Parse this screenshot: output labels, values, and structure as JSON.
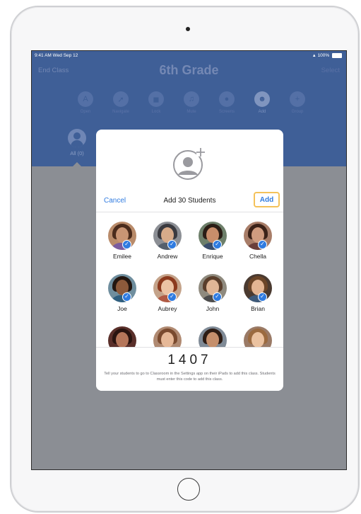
{
  "status_bar": {
    "time": "9:41 AM",
    "date": "Wed Sep 12",
    "battery": "100%"
  },
  "nav": {
    "left_button": "End Class",
    "title": "6th Grade",
    "right_button": "Select"
  },
  "toolbar": [
    {
      "label": "Open",
      "icon": "app-store-icon"
    },
    {
      "label": "Navigate",
      "icon": "compass-icon"
    },
    {
      "label": "Lock",
      "icon": "lock-icon"
    },
    {
      "label": "Mute",
      "icon": "mute-icon"
    },
    {
      "label": "Screens",
      "icon": "binoculars-icon"
    },
    {
      "label": "Add",
      "icon": "add-person-icon"
    },
    {
      "label": "Group",
      "icon": "plus-icon"
    }
  ],
  "group_tab": {
    "label": "All (0)"
  },
  "modal": {
    "cancel_label": "Cancel",
    "title": "Add 30 Students",
    "add_label": "Add",
    "students": [
      {
        "name": "Emilee",
        "selected": true
      },
      {
        "name": "Andrew",
        "selected": true
      },
      {
        "name": "Enrique",
        "selected": true
      },
      {
        "name": "Chella",
        "selected": true
      },
      {
        "name": "Joe",
        "selected": true
      },
      {
        "name": "Aubrey",
        "selected": true
      },
      {
        "name": "John",
        "selected": true
      },
      {
        "name": "Brian",
        "selected": true
      },
      {
        "name": "",
        "selected": false
      },
      {
        "name": "",
        "selected": false
      },
      {
        "name": "",
        "selected": false
      },
      {
        "name": "",
        "selected": false
      }
    ],
    "class_code": "1407",
    "instructions": "Tell your students to go to Classroom in the Settings app on their iPads to add this class. Students must enter this code to add this class."
  },
  "colors": {
    "header": "#3f5f97",
    "accent": "#2f7be0",
    "highlight": "#f4c25a",
    "dim": "#8b8e94"
  }
}
